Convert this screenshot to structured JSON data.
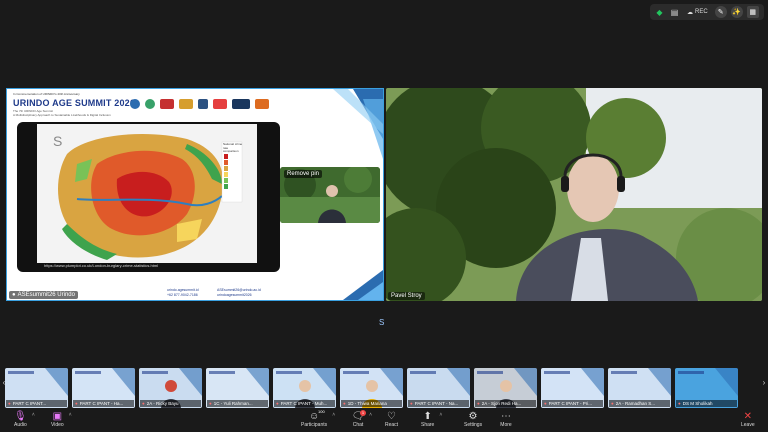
{
  "top_bar": {
    "rec_label": "REC",
    "icons": [
      "shield-icon",
      "document-icon",
      "cloud-icon",
      "edit-icon",
      "effects-icon",
      "grid-icon"
    ]
  },
  "share": {
    "label": "ASEsummit26 Urindo",
    "slide": {
      "small_header": "In Commemoration of URINDO's 40th Anniversary",
      "title": "URINDO AGE SUMMIT 2026",
      "subtitle_1": "The 7th URINDO Age Summit",
      "subtitle_2": "A Multidisciplinary Approach to Sustainable Livelihoods & Digital Inclusion",
      "map_legend_title": "National crime rate comparison",
      "map_url": "https://www.plumplot.co.uk/London-burglary-crime-statistics.html",
      "contacts_left": [
        "urindo.agesummit.id",
        "+62 877-9042-7186"
      ],
      "contacts_right": [
        "ASEsummit26@urindo.ac.id",
        "urindoagesummit2026"
      ]
    },
    "pip_label": "Remove pin"
  },
  "camera": {
    "label": "Pavel Stroy"
  },
  "s_badge": "S",
  "participants": [
    {
      "name": "PART C IPANT..."
    },
    {
      "name": "PART C IPANT - Ha..."
    },
    {
      "name": "2A - Ricky Bayu"
    },
    {
      "name": "1C - Yuli Rahman..."
    },
    {
      "name": "PART C IPANT - Muh..."
    },
    {
      "name": "1D - Thiwa Mariana"
    },
    {
      "name": "PART C IPANT - Na..."
    },
    {
      "name": "2A - Sjori Redi Ha..."
    },
    {
      "name": "PART C IPANT - Pri..."
    },
    {
      "name": "2A - Ramadhan S..."
    },
    {
      "name": "DS M Sholikah"
    }
  ],
  "toolbar": {
    "audio": "Audio",
    "video": "Video",
    "participants": "Participants",
    "participants_count": "100",
    "chat": "Chat",
    "chat_badge": "1",
    "react": "React",
    "share": "Share",
    "settings": "Settings",
    "more": "More",
    "leave": "Leave"
  },
  "colors": {
    "share_border": "#3aa0e0",
    "leave_red": "#ef4444",
    "shield_green": "#22c55e",
    "tile_bg": "#dde9f7"
  }
}
